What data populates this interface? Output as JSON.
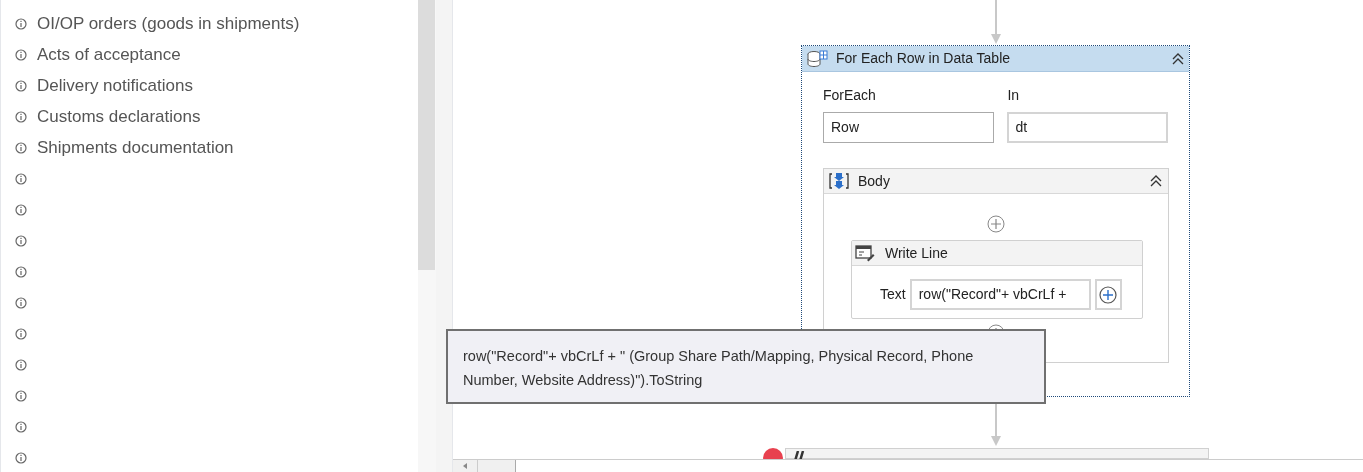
{
  "notes": [
    {
      "kind": "labelled",
      "label": "OI/OP orders (goods in shipments)"
    },
    {
      "kind": "labelled",
      "label": "Acts of acceptance"
    },
    {
      "kind": "labelled",
      "label": "Delivery notifications"
    },
    {
      "kind": "labelled",
      "label": "Customs declarations"
    },
    {
      "kind": "labelled",
      "label": "Shipments documentation"
    },
    {
      "kind": "icon_only"
    },
    {
      "kind": "icon_only"
    },
    {
      "kind": "icon_only"
    },
    {
      "kind": "icon_only"
    },
    {
      "kind": "icon_only"
    },
    {
      "kind": "icon_only"
    },
    {
      "kind": "icon_only"
    },
    {
      "kind": "icon_only"
    },
    {
      "kind": "icon_only"
    },
    {
      "kind": "icon_only"
    }
  ],
  "for_each": {
    "title": "For Each Row in Data Table",
    "foreach_label": "ForEach",
    "foreach_value": "Row",
    "in_label": "In",
    "in_value": "dt",
    "body": {
      "title": "Body",
      "write_line": {
        "title": "Write Line",
        "text_label": "Text",
        "text_value": "row(\"Record\"+ vbCrLf + "
      }
    }
  },
  "tooltip": "row(\"Record\"+ vbCrLf + \" (Group Share Path/Mapping, Physical Record, Phone Number, Website Address)\").ToString"
}
